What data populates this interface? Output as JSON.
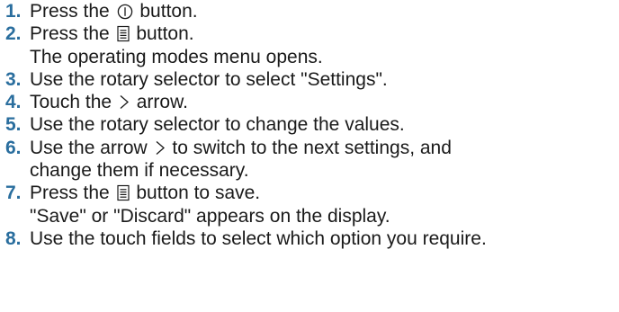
{
  "steps": [
    {
      "num": "1.",
      "pre": "Press the ",
      "icon": "power-icon",
      "post": " button."
    },
    {
      "num": "2.",
      "pre": "Press the ",
      "icon": "menu-icon",
      "post": " button.",
      "sub": "The operating modes menu opens."
    },
    {
      "num": "3.",
      "text": "Use the rotary selector to select \"Settings\"."
    },
    {
      "num": "4.",
      "pre": "Touch the ",
      "icon": "chevron-right-icon",
      "post": " arrow."
    },
    {
      "num": "5.",
      "text": "Use the rotary selector to change the values."
    },
    {
      "num": "6.",
      "pre": "Use the arrow ",
      "icon": "chevron-right-icon",
      "post": " to switch to the next settings, and",
      "sub": "change them if necessary."
    },
    {
      "num": "7.",
      "pre": "Press the ",
      "icon": "menu-icon",
      "post": " button to save.",
      "sub": "\"Save\" or \"Discard\" appears on the display."
    },
    {
      "num": "8.",
      "text": "Use the touch fields to select which option you require."
    }
  ],
  "colors": {
    "step_number": "#2a6e9e",
    "text": "#1a1a1a"
  }
}
